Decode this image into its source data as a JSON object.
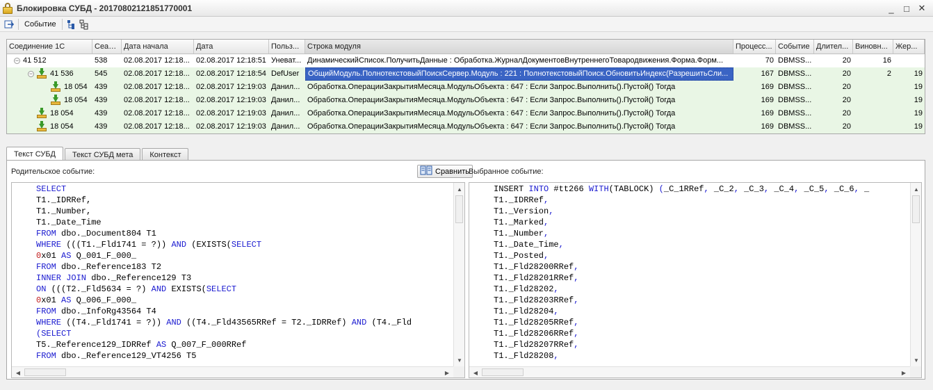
{
  "window": {
    "title": "Блокировка СУБД - 20170802121851770001",
    "controls": {
      "minimize": "_",
      "maximize": "□",
      "close": "✕"
    }
  },
  "toolbar": {
    "event_label": "Событие"
  },
  "grid": {
    "columns": [
      "Соединение 1С",
      "Сеан...",
      "Дата начала",
      "Дата",
      "Польз...",
      "Строка модуля",
      "Процесс...",
      "Событие",
      "Длител...",
      "Виновн...",
      "Жер..."
    ],
    "rows": [
      {
        "level": 0,
        "expander": "⊖",
        "icon": false,
        "green": false,
        "selected": false,
        "cells": [
          "41 512",
          "538",
          "02.08.2017 12:18...",
          "02.08.2017 12:18:51",
          "Уневат...",
          "ДинамическийСписок.ПолучитьДанные : Обработка.ЖурналДокументовВнутреннегоТоваро­движения.Форма.Форм...",
          "70",
          "DBMSS...",
          "20",
          "16",
          ""
        ]
      },
      {
        "level": 1,
        "expander": "⊖",
        "icon": true,
        "green": true,
        "selected": true,
        "cells": [
          "41 536",
          "545",
          "02.08.2017 12:18...",
          "02.08.2017 12:18:54",
          "DefUser",
          "ОбщийМодуль.ПолнотекстовыйПоискСервер.Модуль : 221 : ПолнотекстовыйПоиск.ОбновитьИндекс(РазрешитьСли...",
          "167",
          "DBMSS...",
          "20",
          "2",
          "19"
        ]
      },
      {
        "level": 2,
        "expander": "",
        "icon": true,
        "green": true,
        "selected": false,
        "cells": [
          "18 054",
          "439",
          "02.08.2017 12:18...",
          "02.08.2017 12:19:03",
          "Данил...",
          "Обработка.ОперацииЗакрытияМесяца.МодульОбъекта : 647 : Если Запрос.Выполнить().Пустой() Тогда",
          "169",
          "DBMSS...",
          "20",
          "",
          "19"
        ]
      },
      {
        "level": 2,
        "expander": "",
        "icon": true,
        "green": true,
        "selected": false,
        "cells": [
          "18 054",
          "439",
          "02.08.2017 12:18...",
          "02.08.2017 12:19:03",
          "Данил...",
          "Обработка.ОперацииЗакрытияМесяца.МодульОбъекта : 647 : Если Запрос.Выполнить().Пустой() Тогда",
          "169",
          "DBMSS...",
          "20",
          "",
          "19"
        ]
      },
      {
        "level": 1,
        "expander": "",
        "icon": true,
        "green": true,
        "selected": false,
        "cells": [
          "18 054",
          "439",
          "02.08.2017 12:18...",
          "02.08.2017 12:19:03",
          "Данил...",
          "Обработка.ОперацииЗакрытияМесяца.МодульОбъекта : 647 : Если Запрос.Выполнить().Пустой() Тогда",
          "169",
          "DBMSS...",
          "20",
          "",
          "19"
        ]
      },
      {
        "level": 1,
        "expander": "",
        "icon": true,
        "green": true,
        "selected": false,
        "cells": [
          "18 054",
          "439",
          "02.08.2017 12:18...",
          "02.08.2017 12:19:03",
          "Данил...",
          "Обработка.ОперацииЗакрытияМесяца.МодульОбъекта : 647 : Если Запрос.Выполнить().Пустой() Тогда",
          "169",
          "DBMSS...",
          "20",
          "",
          "19"
        ]
      }
    ]
  },
  "tabs": [
    {
      "label": "Текст СУБД",
      "active": true
    },
    {
      "label": "Текст СУБД мета",
      "active": false
    },
    {
      "label": "Контекст",
      "active": false
    }
  ],
  "panel": {
    "parent_label": "Родительское событие:",
    "selected_label": "Выбранное событие:",
    "compare_label": "Сравнить"
  },
  "code": {
    "left": [
      [
        [
          "kw",
          "SELECT"
        ]
      ],
      [
        [
          "t",
          "T1._IDRRef,"
        ]
      ],
      [
        [
          "t",
          "T1._Number,"
        ]
      ],
      [
        [
          "t",
          "T1._Date_Time"
        ]
      ],
      [
        [
          "kw",
          "FROM"
        ],
        [
          "t",
          " dbo._Document804 T1"
        ]
      ],
      [
        [
          "kw",
          "WHERE"
        ],
        [
          "t",
          " ((("
        ],
        [
          "t",
          "T1._Fld1741 = ?)) "
        ],
        [
          "kw",
          "AND"
        ],
        [
          "t",
          " (EXISTS("
        ],
        [
          "kw",
          "SELECT"
        ]
      ],
      [
        [
          "red",
          "0"
        ],
        [
          "t",
          "x01 "
        ],
        [
          "kw",
          "AS"
        ],
        [
          "t",
          " Q_001_F_000_"
        ]
      ],
      [
        [
          "kw",
          "FROM"
        ],
        [
          "t",
          " dbo._Reference183 T2"
        ]
      ],
      [
        [
          "kw",
          "INNER JOIN"
        ],
        [
          "t",
          " dbo._Reference129 T3"
        ]
      ],
      [
        [
          "kw",
          "ON"
        ],
        [
          "t",
          " (((T2._Fld5634 = ?) "
        ],
        [
          "kw",
          "AND"
        ],
        [
          "t",
          " EXISTS("
        ],
        [
          "kw",
          "SELECT"
        ]
      ],
      [
        [
          "red",
          "0"
        ],
        [
          "t",
          "x01 "
        ],
        [
          "kw",
          "AS"
        ],
        [
          "t",
          " Q_006_F_000_"
        ]
      ],
      [
        [
          "kw",
          "FROM"
        ],
        [
          "t",
          " dbo._InfoRg43564 T4"
        ]
      ],
      [
        [
          "kw",
          "WHERE"
        ],
        [
          "t",
          " ((T4._Fld1741 = ?)) "
        ],
        [
          "kw",
          "AND"
        ],
        [
          "t",
          " ((T4._Fld43565RRef = T2._IDRRef) "
        ],
        [
          "kw",
          "AND"
        ],
        [
          "t",
          " (T4._Fld"
        ]
      ],
      [
        [
          "kw",
          "(SELECT"
        ]
      ],
      [
        [
          "t",
          "T5._Reference129_IDRRef "
        ],
        [
          "kw",
          "AS"
        ],
        [
          "t",
          " Q_007_F_000RRef"
        ]
      ],
      [
        [
          "kw",
          "FROM"
        ],
        [
          "t",
          " dbo._Reference129_VT4256 T5"
        ]
      ]
    ],
    "right": [
      [
        [
          "t",
          "INSERT "
        ],
        [
          "kw",
          "INTO"
        ],
        [
          "t",
          " #tt266 "
        ],
        [
          "kw",
          "WITH"
        ],
        [
          "t",
          "(TABLOCK) "
        ],
        [
          "kw",
          "("
        ],
        [
          "t",
          "_C_1RRef"
        ],
        [
          "kw",
          ","
        ],
        [
          "t",
          " _C_2"
        ],
        [
          "kw",
          ","
        ],
        [
          "t",
          " _C_3"
        ],
        [
          "kw",
          ","
        ],
        [
          "t",
          " _C_4"
        ],
        [
          "kw",
          ","
        ],
        [
          "t",
          " _C_5"
        ],
        [
          "kw",
          ","
        ],
        [
          "t",
          " _C_6"
        ],
        [
          "kw",
          ","
        ],
        [
          "t",
          " _"
        ]
      ],
      [
        [
          "t",
          "T1._IDRRef"
        ],
        [
          "kw",
          ","
        ]
      ],
      [
        [
          "t",
          "T1._Version"
        ],
        [
          "kw",
          ","
        ]
      ],
      [
        [
          "t",
          "T1._Marked"
        ],
        [
          "kw",
          ","
        ]
      ],
      [
        [
          "t",
          "T1._Number"
        ],
        [
          "kw",
          ","
        ]
      ],
      [
        [
          "t",
          "T1._Date_Time"
        ],
        [
          "kw",
          ","
        ]
      ],
      [
        [
          "t",
          "T1._Posted"
        ],
        [
          "kw",
          ","
        ]
      ],
      [
        [
          "t",
          "T1._Fld28200RRef"
        ],
        [
          "kw",
          ","
        ]
      ],
      [
        [
          "t",
          "T1._Fld28201RRef"
        ],
        [
          "kw",
          ","
        ]
      ],
      [
        [
          "t",
          "T1._Fld28202"
        ],
        [
          "kw",
          ","
        ]
      ],
      [
        [
          "t",
          "T1._Fld28203RRef"
        ],
        [
          "kw",
          ","
        ]
      ],
      [
        [
          "t",
          "T1._Fld28204"
        ],
        [
          "kw",
          ","
        ]
      ],
      [
        [
          "t",
          "T1._Fld28205RRef"
        ],
        [
          "kw",
          ","
        ]
      ],
      [
        [
          "t",
          "T1._Fld28206RRef"
        ],
        [
          "kw",
          ","
        ]
      ],
      [
        [
          "t",
          "T1._Fld28207RRef"
        ],
        [
          "kw",
          ","
        ]
      ],
      [
        [
          "t",
          "T1._Fld28208"
        ],
        [
          "kw",
          ","
        ]
      ]
    ]
  }
}
